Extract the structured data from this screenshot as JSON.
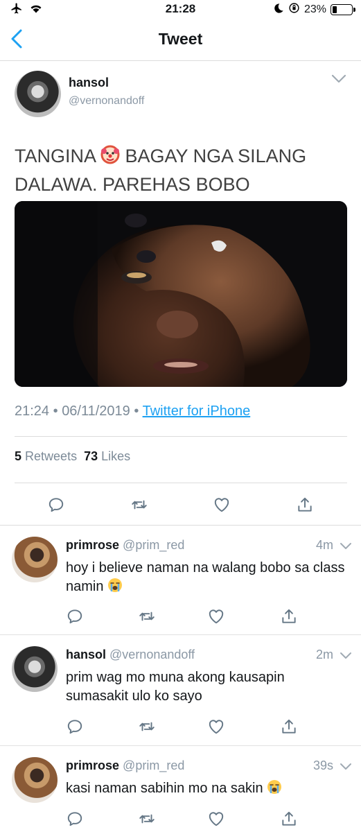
{
  "status_bar": {
    "time": "21:28",
    "battery": "23%",
    "battery_level": 0.23
  },
  "nav": {
    "title": "Tweet"
  },
  "tweet": {
    "author_name": "hansol",
    "author_handle": "@vernonandoff",
    "text_part1": "TANGINA ",
    "text_part2": " BAGAY NGA SILANG DALAWA. PAREHAS BOBO",
    "emoji": "clown-face",
    "time": "21:24",
    "date": "06/11/2019",
    "source": "Twitter for iPhone",
    "retweets_count": "5",
    "retweets_label": "Retweets",
    "likes_count": "73",
    "likes_label": "Likes"
  },
  "replies": [
    {
      "name": "primrose",
      "handle": "@prim_red",
      "time": "4m",
      "text": "hoy i believe naman na walang bobo sa class namin",
      "emoji": "loudly-crying-face"
    },
    {
      "name": "hansol",
      "handle": "@vernonandoff",
      "time": "2m",
      "text": "prim wag mo muna akong kausapin sumasakit ulo ko sayo",
      "emoji": ""
    },
    {
      "name": "primrose",
      "handle": "@prim_red",
      "time": "39s",
      "text": "kasi naman sabihin mo na sakin",
      "emoji": "loudly-crying-face"
    }
  ],
  "colors": {
    "link": "#1da1f2",
    "muted": "#8b98a5",
    "icon": "#657786"
  }
}
